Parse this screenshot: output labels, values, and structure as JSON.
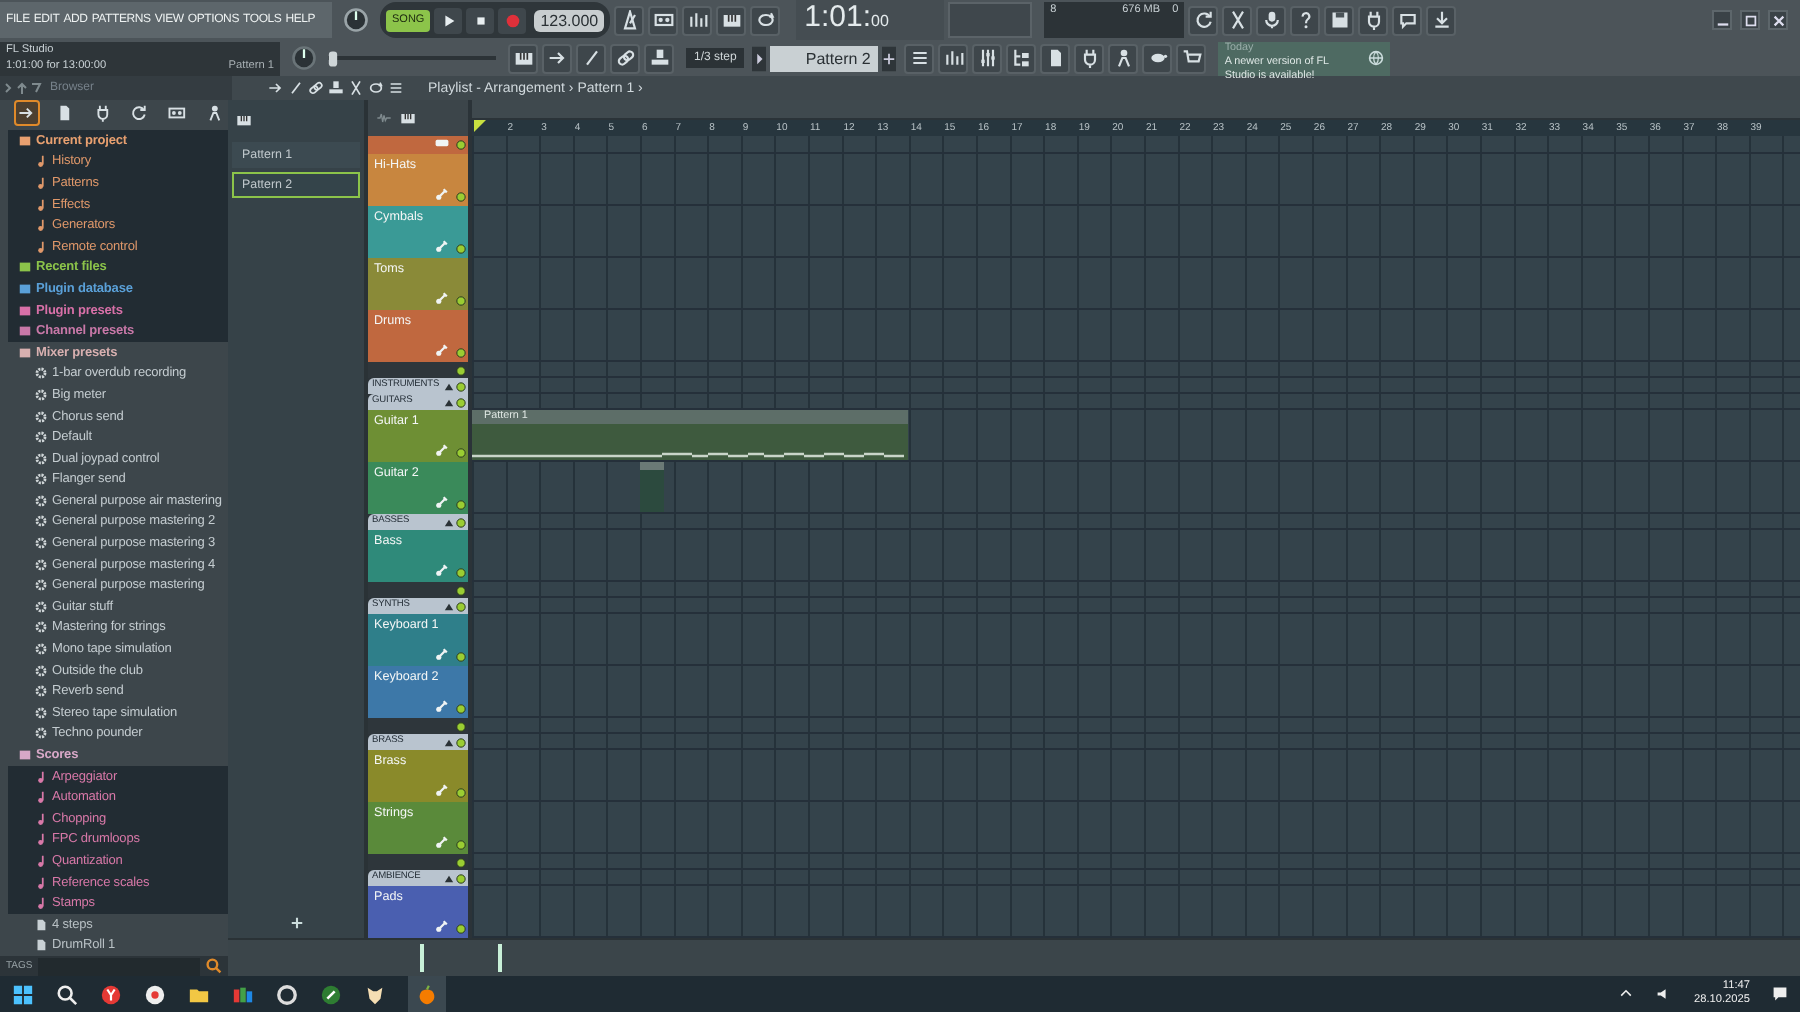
{
  "menu": [
    "FILE",
    "EDIT",
    "ADD",
    "PATTERNS",
    "VIEW",
    "OPTIONS",
    "TOOLS",
    "HELP"
  ],
  "hint_panel": {
    "title": "FL Studio",
    "position": "1:01:00 for 13:00:00",
    "pattern": "Pattern 1"
  },
  "transport": {
    "mode_label": "SONG",
    "song_mode": true,
    "tempo": "123.000"
  },
  "time_display": {
    "main": "1:01:",
    "ticks": "00"
  },
  "cpu_monitor": {
    "polyphony": "8",
    "memory": "676 MB",
    "cpu": "0"
  },
  "pitch_slider": {
    "level": 0
  },
  "snap": "1/3 step",
  "pattern_selector": "Pattern 2",
  "news": {
    "label": "Today",
    "message": "A newer version of FL Studio is available!"
  },
  "browser": {
    "title": "Browser",
    "tabs": [
      {
        "selected": true
      },
      {
        "selected": false
      },
      {
        "selected": false
      },
      {
        "selected": false
      },
      {
        "selected": false
      },
      {
        "selected": false
      }
    ],
    "items": [
      {
        "kind": "folder",
        "label": "Current project",
        "color": "#e8a070",
        "highlighted": true
      },
      {
        "kind": "sub",
        "label": "History",
        "color": "#e0986a",
        "highlighted": true
      },
      {
        "kind": "sub",
        "label": "Patterns",
        "color": "#e0986a",
        "highlighted": true
      },
      {
        "kind": "sub",
        "label": "Effects",
        "color": "#e0986a",
        "highlighted": true
      },
      {
        "kind": "sub",
        "label": "Generators",
        "color": "#e0986a",
        "highlighted": true
      },
      {
        "kind": "sub",
        "label": "Remote control",
        "color": "#e0986a",
        "highlighted": true
      },
      {
        "kind": "folder",
        "label": "Recent files",
        "color": "#8cc44a",
        "highlighted": true
      },
      {
        "kind": "folder",
        "label": "Plugin database",
        "color": "#5aa0d8",
        "highlighted": true
      },
      {
        "kind": "folder",
        "label": "Plugin presets",
        "color": "#d870a8",
        "highlighted": true
      },
      {
        "kind": "folder",
        "label": "Channel presets",
        "color": "#c878a8",
        "highlighted": true
      },
      {
        "kind": "folder",
        "label": "Mixer presets",
        "color": "#d8b0b0",
        "highlighted": false
      },
      {
        "kind": "preset",
        "label": "1-bar overdub recording",
        "color": "#c4ccd0",
        "highlighted": false
      },
      {
        "kind": "preset",
        "label": "Big meter",
        "color": "#c4ccd0",
        "highlighted": false
      },
      {
        "kind": "preset",
        "label": "Chorus send",
        "color": "#c4ccd0",
        "highlighted": false
      },
      {
        "kind": "preset",
        "label": "Default",
        "color": "#c4ccd0",
        "highlighted": false
      },
      {
        "kind": "preset",
        "label": "Dual joypad control",
        "color": "#c4ccd0",
        "highlighted": false
      },
      {
        "kind": "preset",
        "label": "Flanger send",
        "color": "#c4ccd0",
        "highlighted": false
      },
      {
        "kind": "preset",
        "label": "General purpose air mastering",
        "color": "#c4ccd0",
        "highlighted": false
      },
      {
        "kind": "preset",
        "label": "General purpose mastering 2",
        "color": "#c4ccd0",
        "highlighted": false
      },
      {
        "kind": "preset",
        "label": "General purpose mastering 3",
        "color": "#c4ccd0",
        "highlighted": false
      },
      {
        "kind": "preset",
        "label": "General purpose mastering 4",
        "color": "#c4ccd0",
        "highlighted": false
      },
      {
        "kind": "preset",
        "label": "General purpose mastering",
        "color": "#c4ccd0",
        "highlighted": false
      },
      {
        "kind": "preset",
        "label": "Guitar stuff",
        "color": "#c4ccd0",
        "highlighted": false
      },
      {
        "kind": "preset",
        "label": "Mastering for strings",
        "color": "#c4ccd0",
        "highlighted": false
      },
      {
        "kind": "preset",
        "label": "Mono tape simulation",
        "color": "#c4ccd0",
        "highlighted": false
      },
      {
        "kind": "preset",
        "label": "Outside the club",
        "color": "#c4ccd0",
        "highlighted": false
      },
      {
        "kind": "preset",
        "label": "Reverb send",
        "color": "#c4ccd0",
        "highlighted": false
      },
      {
        "kind": "preset",
        "label": "Stereo tape simulation",
        "color": "#c4ccd0",
        "highlighted": false
      },
      {
        "kind": "preset",
        "label": "Techno pounder",
        "color": "#c4ccd0",
        "highlighted": false
      },
      {
        "kind": "folder",
        "label": "Scores",
        "color": "#d8a8c8",
        "highlighted": false
      },
      {
        "kind": "sub",
        "label": "Arpeggiator",
        "color": "#d878a8",
        "highlighted": true
      },
      {
        "kind": "sub",
        "label": "Automation",
        "color": "#d878a8",
        "highlighted": true
      },
      {
        "kind": "sub",
        "label": "Chopping",
        "color": "#d878a8",
        "highlighted": true
      },
      {
        "kind": "sub",
        "label": "FPC drumloops",
        "color": "#d878a8",
        "highlighted": true
      },
      {
        "kind": "sub",
        "label": "Quantization",
        "color": "#d878a8",
        "highlighted": true
      },
      {
        "kind": "sub",
        "label": "Reference scales",
        "color": "#d878a8",
        "highlighted": true
      },
      {
        "kind": "sub",
        "label": "Stamps",
        "color": "#d878a8",
        "highlighted": true
      },
      {
        "kind": "file",
        "label": "4 steps",
        "color": "#b8c0c4",
        "highlighted": false
      },
      {
        "kind": "file",
        "label": "DrumRoll 1",
        "color": "#b8c0c4",
        "highlighted": false
      }
    ],
    "tags_label": "TAGS"
  },
  "patterns": [
    {
      "name": "Pattern 1",
      "selected": false
    },
    {
      "name": "Pattern 2",
      "selected": true
    }
  ],
  "playlist": {
    "title": "Playlist - Arrangement › Pattern 1 ›",
    "ruler": [
      "2",
      "3",
      "4",
      "5",
      "6",
      "7",
      "8",
      "9",
      "10",
      "11",
      "12",
      "13",
      "14",
      "15",
      "16",
      "17",
      "18",
      "19",
      "20",
      "21",
      "22",
      "23",
      "24",
      "25",
      "26",
      "27",
      "28",
      "29",
      "30",
      "31",
      "32",
      "33",
      "34",
      "35",
      "36",
      "37",
      "38",
      "39"
    ],
    "tracks": [
      {
        "kind": "partial",
        "color": "#c0683f"
      },
      {
        "kind": "track",
        "name": "Hi-Hats",
        "color": "#c8863f"
      },
      {
        "kind": "track",
        "name": "Cymbals",
        "color": "#3a9a96"
      },
      {
        "kind": "track",
        "name": "Toms",
        "color": "#8a8a38"
      },
      {
        "kind": "track",
        "name": "Drums",
        "color": "#c0683f"
      },
      {
        "kind": "spacer"
      },
      {
        "kind": "group",
        "label": "INSTRUMENTS"
      },
      {
        "kind": "group",
        "label": "GUITARS"
      },
      {
        "kind": "track",
        "name": "Guitar 1",
        "color": "#6e8f34",
        "clip": "Pattern 1"
      },
      {
        "kind": "track",
        "name": "Guitar 2",
        "color": "#3a8a5a",
        "mini_clip": true
      },
      {
        "kind": "group",
        "label": "BASSES"
      },
      {
        "kind": "track",
        "name": "Bass",
        "color": "#2f8a7a"
      },
      {
        "kind": "spacer"
      },
      {
        "kind": "group",
        "label": "SYNTHS"
      },
      {
        "kind": "track",
        "name": "Keyboard 1",
        "color": "#2f7f8a"
      },
      {
        "kind": "track",
        "name": "Keyboard 2",
        "color": "#3d78a8"
      },
      {
        "kind": "spacer"
      },
      {
        "kind": "group",
        "label": "BRASS"
      },
      {
        "kind": "track",
        "name": "Brass",
        "color": "#8a8a2a"
      },
      {
        "kind": "track",
        "name": "Strings",
        "color": "#5a8a3a"
      },
      {
        "kind": "spacer"
      },
      {
        "kind": "group",
        "label": "AMBIENCE"
      },
      {
        "kind": "track",
        "name": "Pads",
        "color": "#4a5fb0"
      }
    ]
  },
  "taskbar": {
    "time": "11:47",
    "date": "28.10.2025"
  }
}
